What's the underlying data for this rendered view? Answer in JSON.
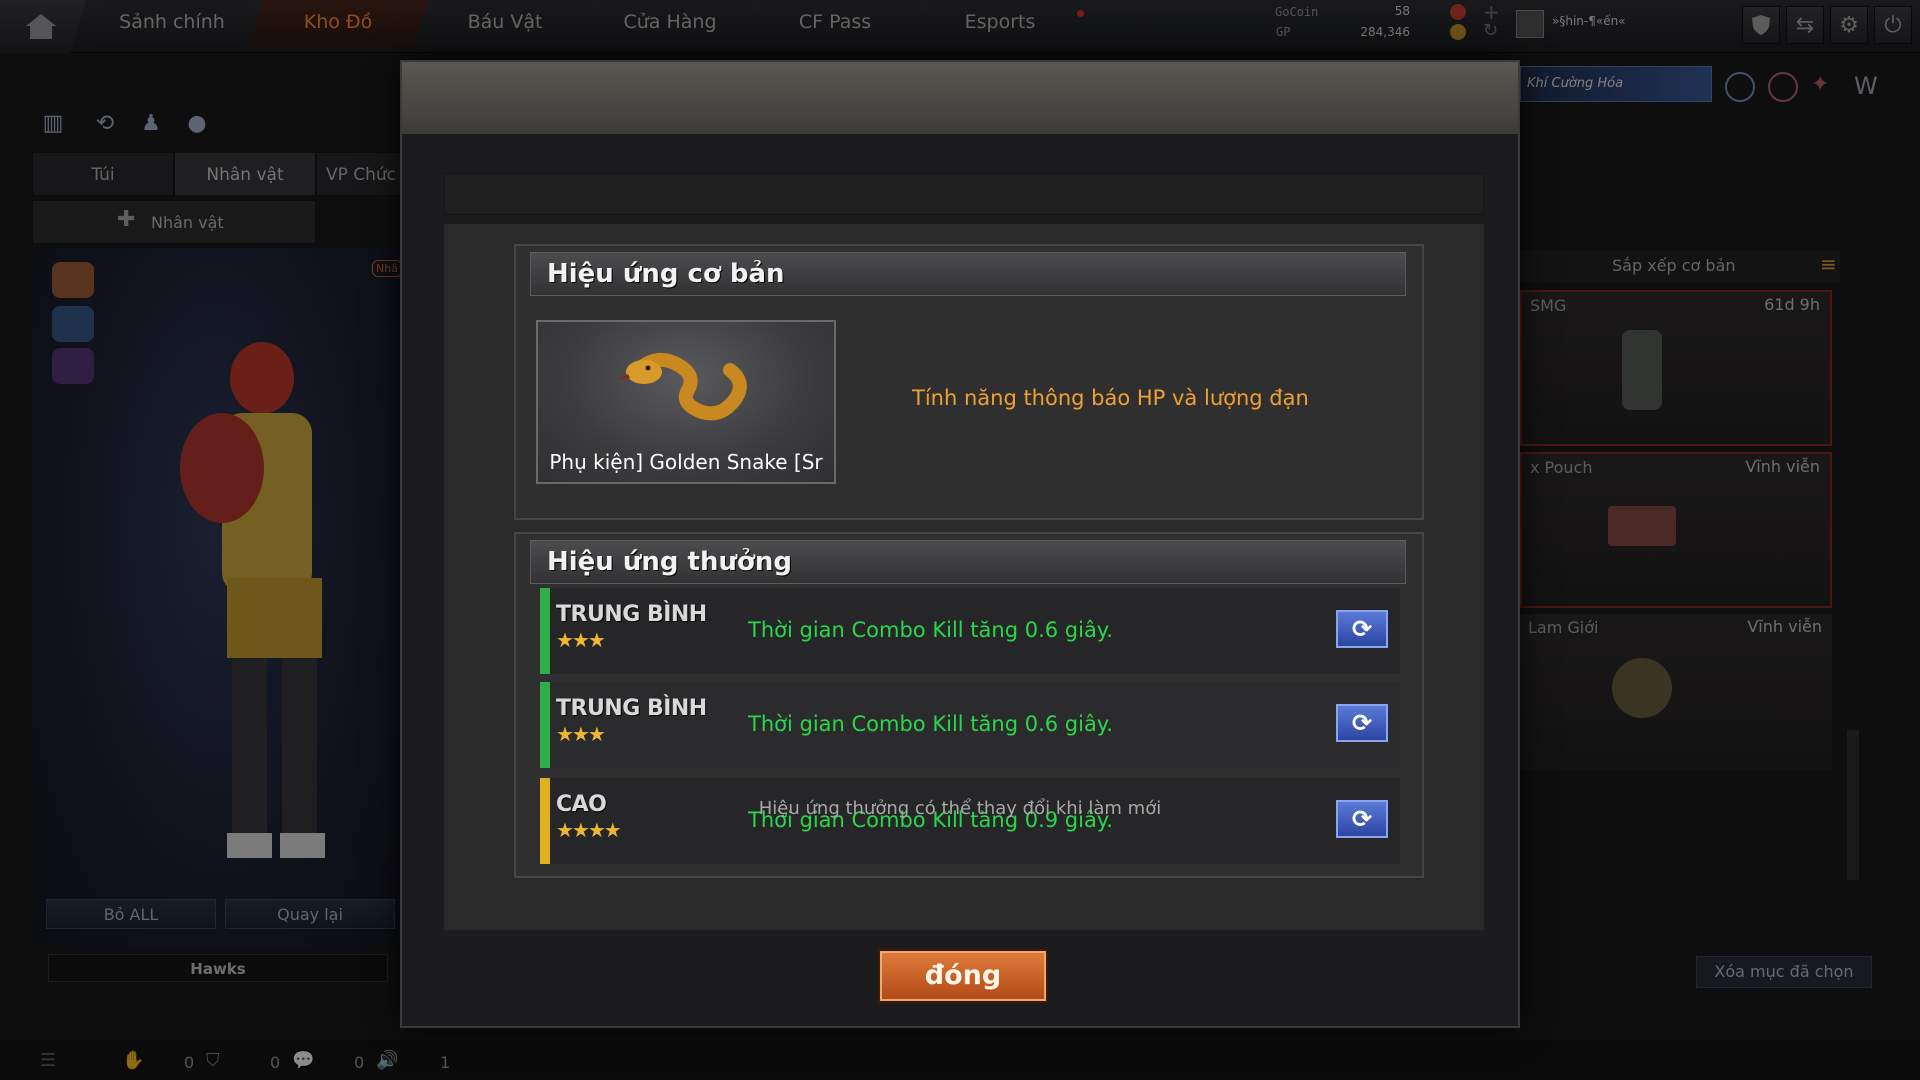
{
  "nav": {
    "tabs": [
      "Sảnh chính",
      "Kho Đồ",
      "Báu Vật",
      "Cửa Hàng",
      "CF Pass",
      "Esports"
    ],
    "active_index": 1
  },
  "currency": {
    "gocoin_label": "GoCoin",
    "gocoin_value": "58",
    "gp_label": "GP",
    "gp_value": "284,346"
  },
  "player": {
    "name": "»§hin-¶«ến«"
  },
  "banner": {
    "label": "Khí Cường Hóa"
  },
  "left_panel": {
    "tabs": [
      "Túi",
      "Nhân vật",
      "VP Chức"
    ],
    "active_tab_index": 1,
    "sub_tab": "Nhân vật",
    "badge": "Nhâ",
    "bo_all": "Bỏ ALL",
    "quay_lai": "Quay lại",
    "clan": "Hawks"
  },
  "right_panel": {
    "sort_label": "Sắp xếp cơ bản",
    "items": [
      {
        "type": "SMG",
        "duration": "61d 9h"
      },
      {
        "type": "x Pouch",
        "duration": "Vĩnh viễn"
      },
      {
        "type": "Lam Giới",
        "duration": "Vĩnh viễn"
      }
    ],
    "clear_selected": "Xóa mục đã chọn"
  },
  "modal": {
    "basic_title": "Hiệu ứng cơ bản",
    "item_name": "Phụ kiện] Golden Snake [Sr",
    "basic_effect": "Tính năng thông báo HP và lượng đạn",
    "bonus_title": "Hiệu ứng thưởng",
    "effects": [
      {
        "tier": "TRUNG BÌNH",
        "stars": "★★★",
        "text": "Thời gian Combo Kill tăng 0.6 giây.",
        "color": "#2fae4a"
      },
      {
        "tier": "TRUNG BÌNH",
        "stars": "★★★",
        "text": "Thời gian Combo Kill tăng 0.6 giây.",
        "color": "#2fae4a"
      },
      {
        "tier": "CAO",
        "stars": "★★★★",
        "text": "Thời gian Combo Kill tăng 0.9 giây.",
        "color": "#e0b020"
      }
    ],
    "hint": "Hiệu ứng thưởng có thể thay đổi khi làm mới",
    "close_label": "đóng"
  },
  "status": {
    "count1": "0",
    "count2": "0",
    "count3": "0",
    "notif": "1"
  },
  "icons": [
    "home-icon",
    "shield-icon",
    "swap-icon",
    "gear-icon",
    "power-icon",
    "refresh-icon",
    "snake-icon"
  ]
}
